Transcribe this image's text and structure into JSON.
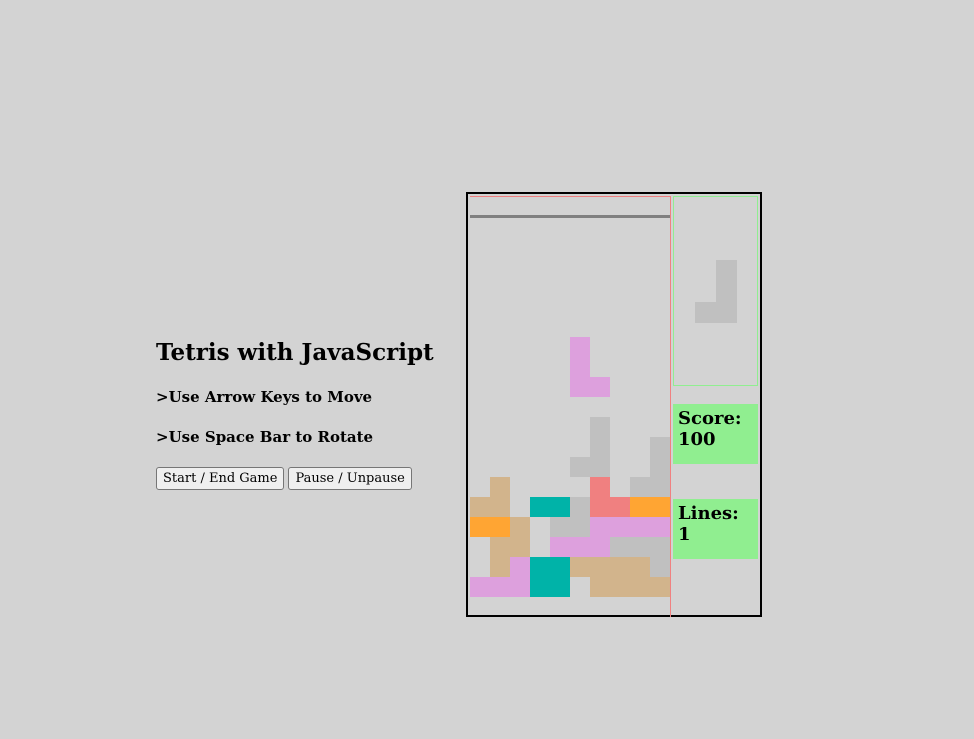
{
  "header": {
    "title": "Tetris with JavaScript",
    "instructions": [
      ">Use Arrow Keys to Move",
      ">Use Space Bar to Rotate"
    ]
  },
  "controls": {
    "start_label": "Start / End Game",
    "pause_label": "Pause / Unpause"
  },
  "stats": {
    "score_label": "Score:",
    "score_value": "100",
    "lines_label": "Lines:",
    "lines_value": "1"
  },
  "colors": {
    "background": "#d3d3d3",
    "panel": "#90ee90",
    "falling_piece": "#dda0dd",
    "tan": "#d2b48c",
    "orange": "#ffa533",
    "teal": "#00b3a8",
    "salmon": "#f08080",
    "plum": "#dda0dd",
    "gray": "#c0c0c0"
  },
  "board": {
    "columns": 10,
    "rows": 21,
    "falling_piece": {
      "color": "plum",
      "cells": [
        [
          5,
          8
        ],
        [
          5,
          9
        ],
        [
          5,
          10
        ],
        [
          6,
          10
        ]
      ]
    },
    "settled_cells": [
      {
        "c": 6,
        "r": 12,
        "color": "gray"
      },
      {
        "c": 6,
        "r": 13,
        "color": "gray"
      },
      {
        "c": 5,
        "r": 14,
        "color": "gray"
      },
      {
        "c": 6,
        "r": 14,
        "color": "gray"
      },
      {
        "c": 9,
        "r": 13,
        "color": "gray"
      },
      {
        "c": 9,
        "r": 14,
        "color": "gray"
      },
      {
        "c": 8,
        "r": 15,
        "color": "gray"
      },
      {
        "c": 9,
        "r": 15,
        "color": "gray"
      },
      {
        "c": 1,
        "r": 15,
        "color": "tan"
      },
      {
        "c": 0,
        "r": 16,
        "color": "tan"
      },
      {
        "c": 1,
        "r": 16,
        "color": "tan"
      },
      {
        "c": 3,
        "r": 16,
        "color": "teal"
      },
      {
        "c": 4,
        "r": 16,
        "color": "teal"
      },
      {
        "c": 5,
        "r": 16,
        "color": "gray"
      },
      {
        "c": 6,
        "r": 15,
        "color": "salmon"
      },
      {
        "c": 6,
        "r": 16,
        "color": "salmon"
      },
      {
        "c": 7,
        "r": 16,
        "color": "salmon"
      },
      {
        "c": 8,
        "r": 16,
        "color": "orange"
      },
      {
        "c": 9,
        "r": 16,
        "color": "orange"
      },
      {
        "c": 0,
        "r": 17,
        "color": "orange"
      },
      {
        "c": 1,
        "r": 17,
        "color": "orange"
      },
      {
        "c": 2,
        "r": 17,
        "color": "tan"
      },
      {
        "c": 4,
        "r": 17,
        "color": "gray"
      },
      {
        "c": 5,
        "r": 17,
        "color": "gray"
      },
      {
        "c": 6,
        "r": 17,
        "color": "plum"
      },
      {
        "c": 7,
        "r": 17,
        "color": "plum"
      },
      {
        "c": 8,
        "r": 17,
        "color": "plum"
      },
      {
        "c": 9,
        "r": 17,
        "color": "plum"
      },
      {
        "c": 1,
        "r": 18,
        "color": "tan"
      },
      {
        "c": 2,
        "r": 18,
        "color": "tan"
      },
      {
        "c": 4,
        "r": 18,
        "color": "plum"
      },
      {
        "c": 5,
        "r": 18,
        "color": "plum"
      },
      {
        "c": 6,
        "r": 18,
        "color": "plum"
      },
      {
        "c": 7,
        "r": 18,
        "color": "gray"
      },
      {
        "c": 8,
        "r": 18,
        "color": "gray"
      },
      {
        "c": 9,
        "r": 18,
        "color": "gray"
      },
      {
        "c": 1,
        "r": 19,
        "color": "tan"
      },
      {
        "c": 2,
        "r": 19,
        "color": "plum"
      },
      {
        "c": 3,
        "r": 19,
        "color": "teal"
      },
      {
        "c": 4,
        "r": 19,
        "color": "teal"
      },
      {
        "c": 5,
        "r": 19,
        "color": "tan"
      },
      {
        "c": 6,
        "r": 19,
        "color": "tan"
      },
      {
        "c": 7,
        "r": 19,
        "color": "tan"
      },
      {
        "c": 8,
        "r": 19,
        "color": "tan"
      },
      {
        "c": 9,
        "r": 19,
        "color": "gray"
      },
      {
        "c": 0,
        "r": 20,
        "color": "plum"
      },
      {
        "c": 1,
        "r": 20,
        "color": "plum"
      },
      {
        "c": 2,
        "r": 20,
        "color": "plum"
      },
      {
        "c": 3,
        "r": 20,
        "color": "teal"
      },
      {
        "c": 4,
        "r": 20,
        "color": "teal"
      },
      {
        "c": 6,
        "r": 20,
        "color": "tan"
      },
      {
        "c": 7,
        "r": 20,
        "color": "tan"
      },
      {
        "c": 8,
        "r": 20,
        "color": "tan"
      },
      {
        "c": 9,
        "r": 20,
        "color": "tan"
      }
    ]
  },
  "next_piece": {
    "color": "gray",
    "cells": [
      [
        1,
        0
      ],
      [
        1,
        1
      ],
      [
        1,
        2
      ],
      [
        0,
        2
      ]
    ]
  }
}
